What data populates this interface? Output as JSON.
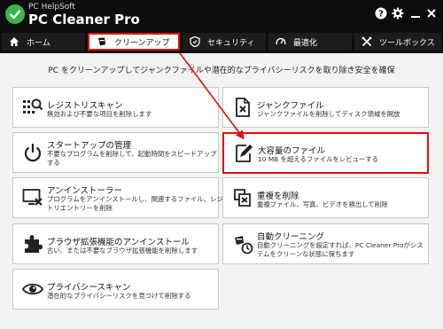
{
  "app": {
    "brand_sub": "PC HelpSoft",
    "brand_main": "PC Cleaner Pro",
    "help_icon": "help-icon",
    "settings_icon": "gear-icon",
    "minimize_icon": "minimize-icon",
    "close_icon": "close-icon"
  },
  "tabs": [
    {
      "label": "ホーム",
      "icon": "home-icon"
    },
    {
      "label": "クリーンアップ",
      "icon": "broom-icon"
    },
    {
      "label": "セキュリティ",
      "icon": "shield-icon"
    },
    {
      "label": "最適化",
      "icon": "speedometer-icon"
    },
    {
      "label": "ツールボックス",
      "icon": "tools-icon"
    }
  ],
  "active_tab": "クリーンアップ",
  "subtitle": "PC をクリーンアップしてジャンクファイルや潜在的なプライバシーリスクを取り除き安全を確保",
  "cards": {
    "registry": {
      "title": "レジストリスキャン",
      "desc": [
        "無効および不要な項目を削除します"
      ],
      "icon": "registry-scan-icon"
    },
    "junk": {
      "title": "ジャンクファイル",
      "desc": [
        "ジャンクファイルを削除してディスク領域を開放"
      ],
      "icon": "junk-file-icon"
    },
    "startup": {
      "title": "スタートアップの管理",
      "desc": [
        "不要なプログラムを削除して、起動時間をスピードアップ",
        "する"
      ],
      "icon": "power-icon"
    },
    "large": {
      "title": "大容量のファイル",
      "desc": [
        "10 MB を超えるファイルをレビューする"
      ],
      "icon": "large-file-icon"
    },
    "uninstall": {
      "title": "アンインストーラー",
      "desc": [
        "プログラムをアンインストールし、関連するファイル、レジス",
        "トリエントリーを削除"
      ],
      "icon": "uninstall-icon"
    },
    "duplicate": {
      "title": "重複を削除",
      "desc": [
        "重複ファイル、写真、ビデオを検出して削除"
      ],
      "icon": "duplicate-icon"
    },
    "extension": {
      "title": "ブラウザ拡張機能のアンインストール",
      "desc": [
        "古い、または不要なブラウザ拡張機能を削除します"
      ],
      "icon": "puzzle-icon"
    },
    "auto": {
      "title": "自動クリーニング",
      "desc": [
        "自動クリーニングを設定すれば、PC Cleaner Proがシス",
        "テムをクリーンな状態に保ちます"
      ],
      "icon": "auto-clean-icon"
    },
    "privacy": {
      "title": "プライバシースキャン",
      "desc": [
        "潜在的なプライバシーリスクを見つけて削除する"
      ],
      "icon": "privacy-eye-icon"
    }
  },
  "colors": {
    "titlebar": "#0d0d0d",
    "tab_bg": "#1c1c1c",
    "highlight": "#e01010",
    "logo": "#3bb54a"
  }
}
